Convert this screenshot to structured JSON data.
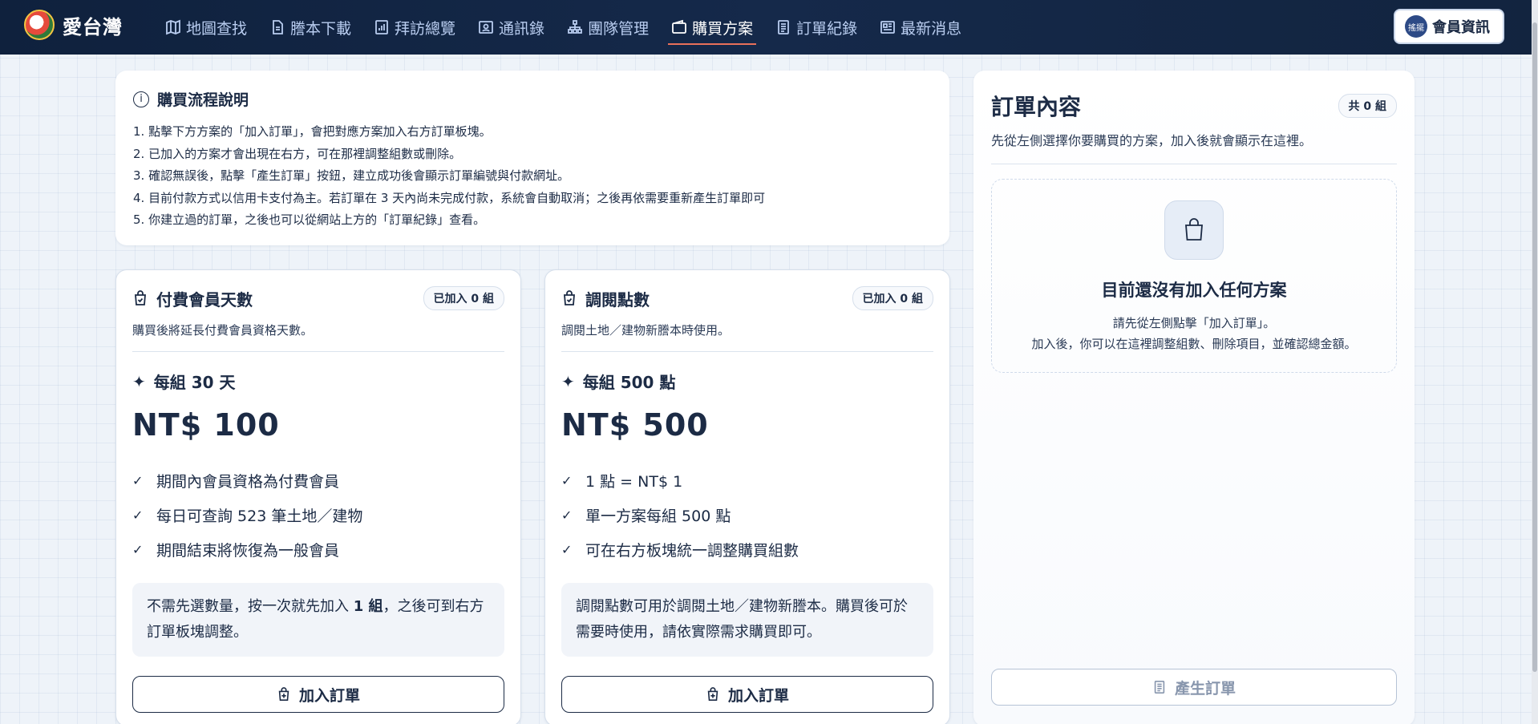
{
  "brand": {
    "name": "愛台灣"
  },
  "nav": {
    "items": [
      {
        "label": "地圖查找",
        "icon": "map-icon"
      },
      {
        "label": "謄本下載",
        "icon": "document-icon"
      },
      {
        "label": "拜訪總覽",
        "icon": "chart-icon"
      },
      {
        "label": "通訊錄",
        "icon": "contact-icon"
      },
      {
        "label": "團隊管理",
        "icon": "team-icon"
      },
      {
        "label": "購買方案",
        "icon": "wallet-icon",
        "active": true
      },
      {
        "label": "訂單紀錄",
        "icon": "receipt-icon"
      },
      {
        "label": "最新消息",
        "icon": "news-icon"
      }
    ],
    "member": {
      "avatar_text": "搖擺",
      "label": "會員資訊"
    }
  },
  "process": {
    "title": "購買流程說明",
    "steps": [
      "1. 點擊下方方案的「加入訂單」，會把對應方案加入右方訂單板塊。",
      "2. 已加入的方案才會出現在右方，可在那裡調整組數或刪除。",
      "3. 確認無誤後，點擊「產生訂單」按鈕，建立成功後會顯示訂單編號與付款網址。",
      "4. 目前付款方式以信用卡支付為主。若訂單在 3 天內尚未完成付款，系統會自動取消；之後再依需要重新產生訂單即可",
      "5. 你建立過的訂單，之後也可以從網站上方的「訂單紀錄」查看。"
    ]
  },
  "plans": [
    {
      "title": "付費會員天數",
      "added": "已加入 0 組",
      "desc": "購買後將延長付費會員資格天數。",
      "unit": "每組 30 天",
      "price": "NT$ 100",
      "features": [
        "期間內會員資格為付費會員",
        "每日可查詢 523 筆土地／建物",
        "期間結束將恢復為一般會員"
      ],
      "note_pre": "不需先選數量，按一次就先加入 ",
      "note_bold": "1 組",
      "note_post": "，之後可到右方訂單板塊調整。",
      "button": "加入訂單"
    },
    {
      "title": "調閱點數",
      "added": "已加入 0 組",
      "desc": "調閱土地／建物新謄本時使用。",
      "unit": "每組 500 點",
      "price": "NT$ 500",
      "features": [
        "1 點 = NT$ 1",
        "單一方案每組 500 點",
        "可在右方板塊統一調整購買組數"
      ],
      "note_pre": "調閱點數可用於調閱土地／建物新謄本。購買後可於需要時使用，請依實際需求購買即可。",
      "note_bold": "",
      "note_post": "",
      "button": "加入訂單"
    }
  ],
  "order": {
    "title": "訂單內容",
    "count": "共 0 組",
    "desc": "先從左側選擇你要購買的方案，加入後就會顯示在這裡。",
    "empty_title": "目前還沒有加入任何方案",
    "empty_line1": "請先從左側點擊「加入訂單」。",
    "empty_line2": "加入後，你可以在這裡調整組數、刪除項目，並確認總金額。",
    "create_button": "產生訂單"
  }
}
